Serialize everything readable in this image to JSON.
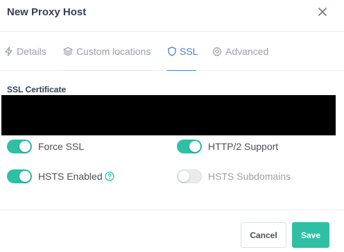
{
  "modal": {
    "title": "New Proxy Host",
    "close_icon": "close-icon"
  },
  "tabs": [
    {
      "label": "Details",
      "icon": "bolt-icon",
      "active": false
    },
    {
      "label": "Custom locations",
      "icon": "layers-icon",
      "active": false
    },
    {
      "label": "SSL",
      "icon": "shield-icon",
      "active": true
    },
    {
      "label": "Advanced",
      "icon": "gear-icon",
      "active": false
    }
  ],
  "ssl": {
    "certificate_label": "SSL Certificate",
    "toggles": [
      {
        "label": "Force SSL",
        "checked": true
      },
      {
        "label": "HTTP/2 Support",
        "checked": true
      },
      {
        "label": "HSTS Enabled",
        "checked": true,
        "help_icon": "help-circle-icon"
      },
      {
        "label": "HSTS Subdomains",
        "checked": false
      }
    ]
  },
  "footer": {
    "cancel_label": "Cancel",
    "save_label": "Save"
  },
  "colors": {
    "accent_teal": "#2fbfa5",
    "active_tab_blue": "#467fcf"
  }
}
